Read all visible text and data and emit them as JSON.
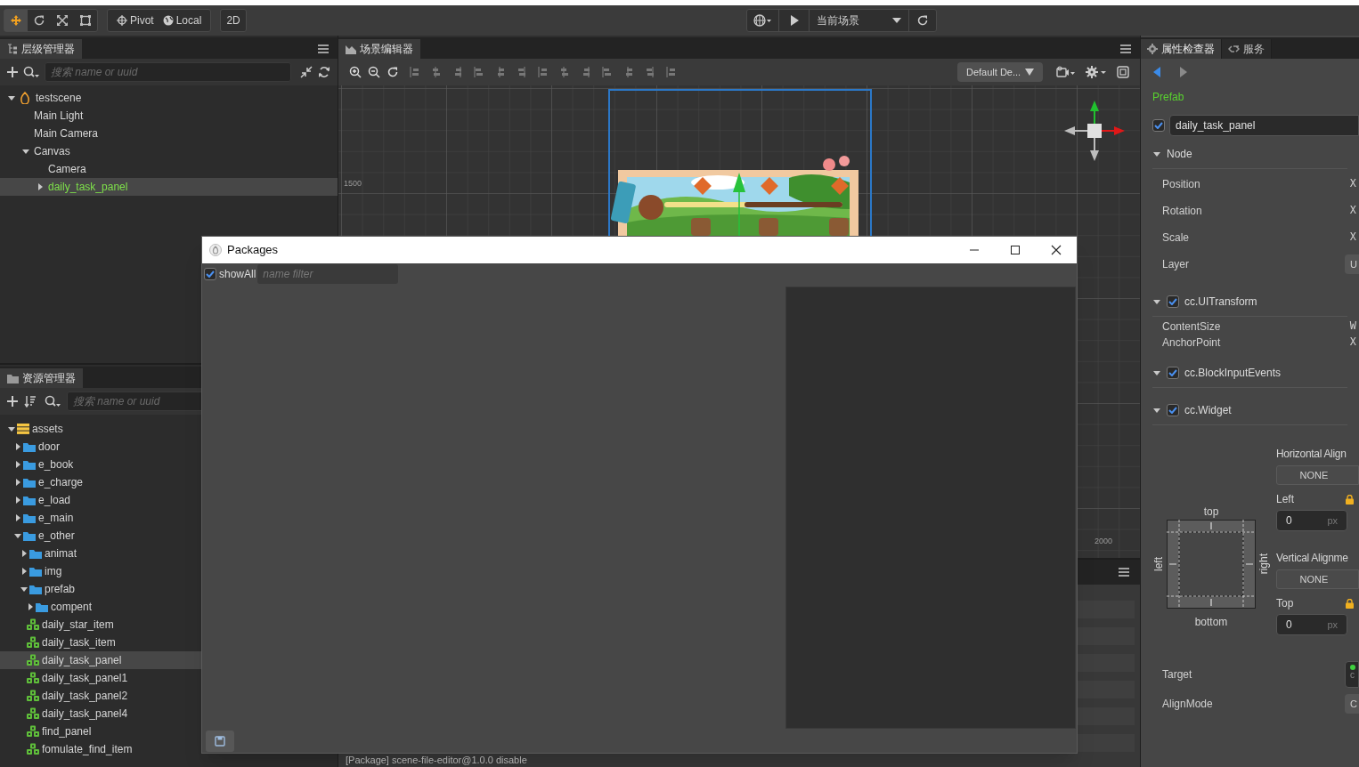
{
  "toolbar": {
    "transform_tools": [
      {
        "kind": "move",
        "selected": true
      },
      {
        "kind": "rotate",
        "selected": false
      },
      {
        "kind": "scale",
        "selected": false
      },
      {
        "kind": "rect",
        "selected": false
      }
    ],
    "pivot": "Pivot",
    "coordinate": "Local",
    "mode": "2D",
    "preview_target": "当前场景"
  },
  "hierarchy": {
    "title": "层级管理器",
    "search_placeholder": "搜索 name or uuid",
    "tree": [
      {
        "label": "testscene",
        "kind": "scene",
        "expanded": true,
        "selected": false,
        "children": [
          {
            "label": "Main Light",
            "kind": "node",
            "selected": false
          },
          {
            "label": "Main Camera",
            "kind": "node",
            "selected": false
          },
          {
            "label": "Canvas",
            "kind": "node",
            "expanded": true,
            "selected": false,
            "children": [
              {
                "label": "Camera",
                "kind": "node",
                "selected": false
              },
              {
                "label": "daily_task_panel",
                "kind": "prefab_node",
                "expanded": false,
                "selected": true
              }
            ]
          }
        ]
      }
    ]
  },
  "assets": {
    "title": "资源管理器",
    "search_placeholder": "搜索 name or uuid",
    "tree": [
      {
        "label": "assets",
        "kind": "db",
        "expanded": true,
        "selected": false,
        "children": [
          {
            "label": "door",
            "kind": "folder",
            "expanded": false,
            "selected": false
          },
          {
            "label": "e_book",
            "kind": "folder",
            "expanded": false,
            "selected": false
          },
          {
            "label": "e_charge",
            "kind": "folder",
            "expanded": false,
            "selected": false
          },
          {
            "label": "e_load",
            "kind": "folder",
            "expanded": false,
            "selected": false
          },
          {
            "label": "e_main",
            "kind": "folder",
            "expanded": false,
            "selected": false
          },
          {
            "label": "e_other",
            "kind": "folder",
            "expanded": true,
            "selected": false,
            "children": [
              {
                "label": "animat",
                "kind": "folder",
                "expanded": false,
                "selected": false
              },
              {
                "label": "img",
                "kind": "folder",
                "expanded": false,
                "selected": false
              },
              {
                "label": "prefab",
                "kind": "folder",
                "expanded": true,
                "selected": false,
                "children": [
                  {
                    "label": "compent",
                    "kind": "folder",
                    "expanded": false,
                    "selected": false
                  },
                  {
                    "label": "daily_star_item",
                    "kind": "prefab",
                    "selected": false
                  },
                  {
                    "label": "daily_task_item",
                    "kind": "prefab",
                    "selected": false
                  },
                  {
                    "label": "daily_task_panel",
                    "kind": "prefab",
                    "selected": true
                  },
                  {
                    "label": "daily_task_panel1",
                    "kind": "prefab",
                    "selected": false
                  },
                  {
                    "label": "daily_task_panel2",
                    "kind": "prefab",
                    "selected": false
                  },
                  {
                    "label": "daily_task_panel4",
                    "kind": "prefab",
                    "selected": false
                  },
                  {
                    "label": "find_panel",
                    "kind": "prefab",
                    "selected": false
                  },
                  {
                    "label": "fomulate_find_item",
                    "kind": "prefab",
                    "selected": false
                  }
                ]
              }
            ]
          }
        ]
      }
    ]
  },
  "scene_editor": {
    "title": "场景编辑器",
    "design_resolution": "Default De...",
    "ruler_labels": [
      "1500",
      "2000"
    ],
    "console_line": "[Package] scene-file-editor@1.0.0 disable"
  },
  "packages_window": {
    "title": "Packages",
    "show_all": {
      "label": "showAll",
      "checked": true
    },
    "filter_placeholder": "name filter"
  },
  "inspector": {
    "tabs": [
      {
        "label": "属性检查器",
        "selected": true
      },
      {
        "label": "服务",
        "selected": false
      }
    ],
    "asset_type": "Prefab",
    "node_active": true,
    "node_name": "daily_task_panel",
    "node_section": {
      "title": "Node",
      "properties": [
        {
          "label": "Position",
          "kind": "axis",
          "value": "X"
        },
        {
          "label": "Rotation",
          "kind": "axis",
          "value": "X"
        },
        {
          "label": "Scale",
          "kind": "axis",
          "value": "X"
        },
        {
          "label": "Layer",
          "kind": "button",
          "value": "U"
        }
      ]
    },
    "components": [
      {
        "title": "cc.UITransform",
        "enabled": true,
        "properties": [
          {
            "label": "ContentSize",
            "kind": "axis",
            "value": "W"
          },
          {
            "label": "AnchorPoint",
            "kind": "axis",
            "value": "X"
          }
        ]
      },
      {
        "title": "cc.BlockInputEvents",
        "enabled": true
      },
      {
        "title": "cc.Widget",
        "enabled": true
      }
    ],
    "widget": {
      "horizontal_label": "Horizontal Align",
      "horizontal_value": "NONE",
      "left_label": "Left",
      "left_value": "0",
      "left_unit": "px",
      "vertical_label": "Vertical Alignme",
      "vertical_value": "NONE",
      "top_label": "Top",
      "top_value": "0",
      "top_unit": "px",
      "diagram_top": "top",
      "diagram_left": "left",
      "diagram_right": "right",
      "diagram_bottom": "bottom",
      "target_label": "Target",
      "target_value": "c",
      "align_mode_label": "AlignMode",
      "align_mode_value": "C"
    }
  }
}
